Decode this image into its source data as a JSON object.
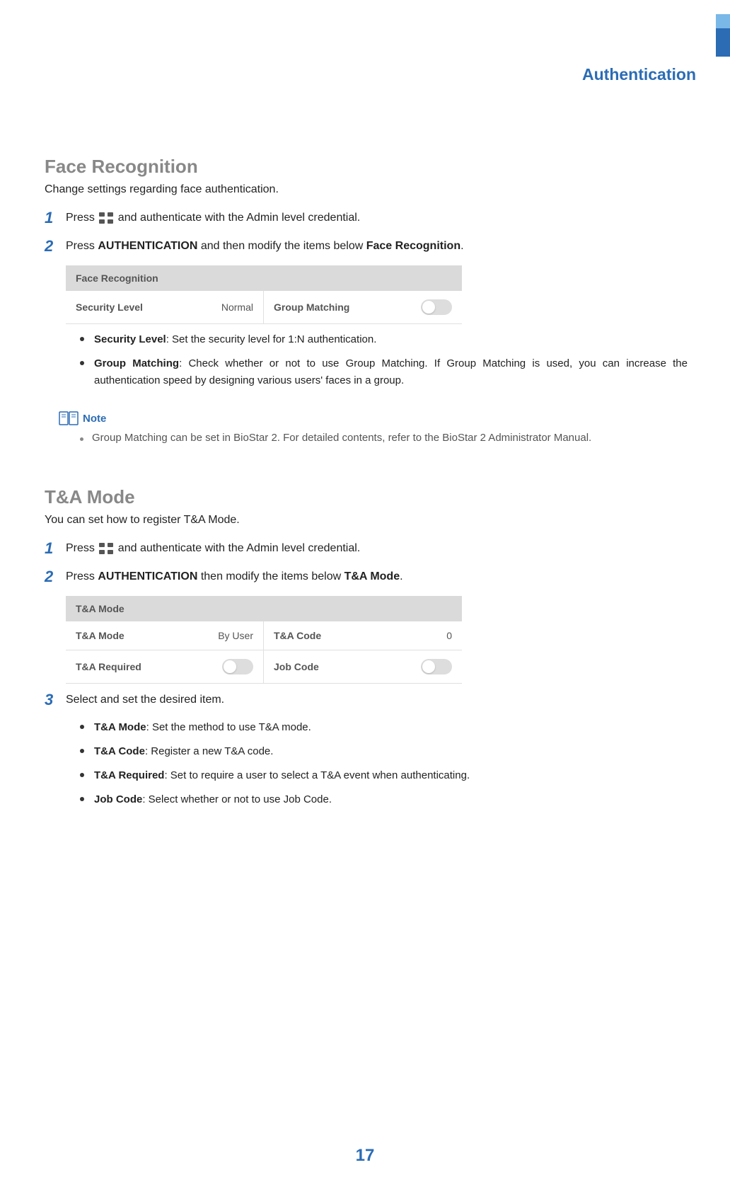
{
  "header": {
    "chapter": "Authentication"
  },
  "section1": {
    "title": "Face Recognition",
    "desc": "Change settings regarding face authentication.",
    "steps": {
      "s1": {
        "num": "1",
        "pre": "Press ",
        "post": " and authenticate with the Admin level credential."
      },
      "s2": {
        "num": "2",
        "pre": "Press ",
        "bold": "AUTHENTICATION",
        "mid": " and then modify the items below ",
        "bold2": "Face Recognition",
        "post": "."
      }
    },
    "panel": {
      "header": "Face Recognition",
      "row1_label": "Security Level",
      "row1_value": "Normal",
      "row2_label": "Group Matching"
    },
    "bullets": {
      "b1": {
        "bold": "Security Level",
        "text": ": Set the security level for 1:N authentication."
      },
      "b2": {
        "bold": "Group Matching",
        "text": ": Check whether or not to use Group Matching. If Group Matching is used, you can increase the authentication speed by designing various users' faces in a group."
      }
    },
    "note": {
      "label": "Note",
      "text": "Group Matching can be set in BioStar 2. For detailed contents, refer to the BioStar 2 Administrator Manual."
    }
  },
  "section2": {
    "title": "T&A Mode",
    "desc": "You can set how to register T&A Mode.",
    "steps": {
      "s1": {
        "num": "1",
        "pre": "Press ",
        "post": " and authenticate with the Admin level credential."
      },
      "s2": {
        "num": "2",
        "pre": "Press ",
        "bold": "AUTHENTICATION",
        "mid": " then modify the items below ",
        "bold2": "T&A Mode",
        "post": "."
      },
      "s3": {
        "num": "3",
        "text": "Select and set the desired item."
      }
    },
    "panel": {
      "header": "T&A Mode",
      "r1c1_label": "T&A Mode",
      "r1c1_value": "By User",
      "r1c2_label": "T&A Code",
      "r1c2_value": "0",
      "r2c1_label": "T&A Required",
      "r2c2_label": "Job Code"
    },
    "bullets": {
      "b1": {
        "bold": "T&A Mode",
        "text": ": Set the method to use T&A mode."
      },
      "b2": {
        "bold": "T&A Code",
        "text": ": Register a new T&A code."
      },
      "b3": {
        "bold": "T&A Required",
        "text": ": Set to require a user to select a T&A event when authenticating."
      },
      "b4": {
        "bold": "Job Code",
        "text": ": Select whether or not to use Job Code."
      }
    }
  },
  "page_number": "17"
}
